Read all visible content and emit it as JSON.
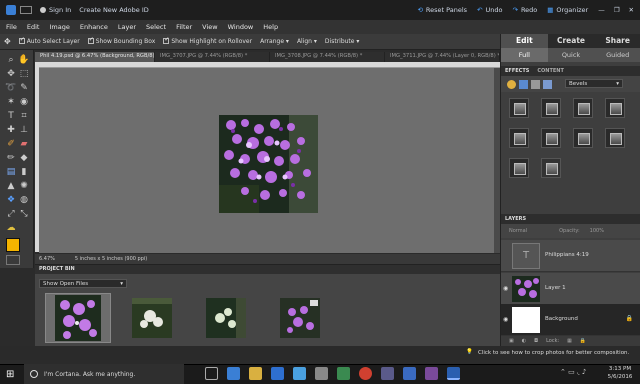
{
  "titlebar": {
    "signin": "Sign In",
    "create_id": "Create New Adobe ID",
    "reset_panels": "Reset Panels",
    "undo": "Undo",
    "redo": "Redo",
    "organizer": "Organizer"
  },
  "menu": [
    "File",
    "Edit",
    "Image",
    "Enhance",
    "Layer",
    "Select",
    "Filter",
    "View",
    "Window",
    "Help"
  ],
  "options": {
    "auto_select": "Auto Select Layer",
    "bounding_box": "Show Bounding Box",
    "highlight": "Show Highlight on Rollover",
    "arrange": "Arrange",
    "align": "Align",
    "distribute": "Distribute"
  },
  "doc_tabs": [
    "Phil 4.19.psd @ 6.47% (Background, RGB/8) *",
    "IMG_3707.JPG @ 7.44% (RGB/8) *",
    "IMG_3708.JPG @ 7.44% (RGB/8) *",
    "IMG_3711.JPG @ 7.44% (Layer 0, RGB/8) *"
  ],
  "status": {
    "zoom": "6.47%",
    "doc_size": "5 inches x 5 inches (900 ppi)"
  },
  "project_bin": {
    "title": "PROJECT BIN",
    "filter": "Show Open Files"
  },
  "modes": {
    "edit": "Edit",
    "create": "Create",
    "share": "Share"
  },
  "submodes": {
    "full": "Full",
    "quick": "Quick",
    "guided": "Guided"
  },
  "effects": {
    "tab1": "EFFECTS",
    "tab2": "CONTENT",
    "dropdown": "Bevels"
  },
  "layers_panel": {
    "title": "LAYERS",
    "blend": "Normal",
    "opacity_label": "Opacity:",
    "opacity": "100%",
    "lock_label": "Lock:",
    "items": [
      {
        "name": "Philippians 4:19"
      },
      {
        "name": "Layer 1"
      },
      {
        "name": "Background"
      }
    ]
  },
  "hint": "Click to see how to crop photos for better composition.",
  "taskbar": {
    "search": "I'm Cortana. Ask me anything.",
    "time": "3:13 PM",
    "date": "5/6/2016"
  },
  "colors": {
    "accent_blue": "#4ea3ff",
    "fg_swatch": "#f5b400",
    "bg_swatch": "#ffffff"
  }
}
